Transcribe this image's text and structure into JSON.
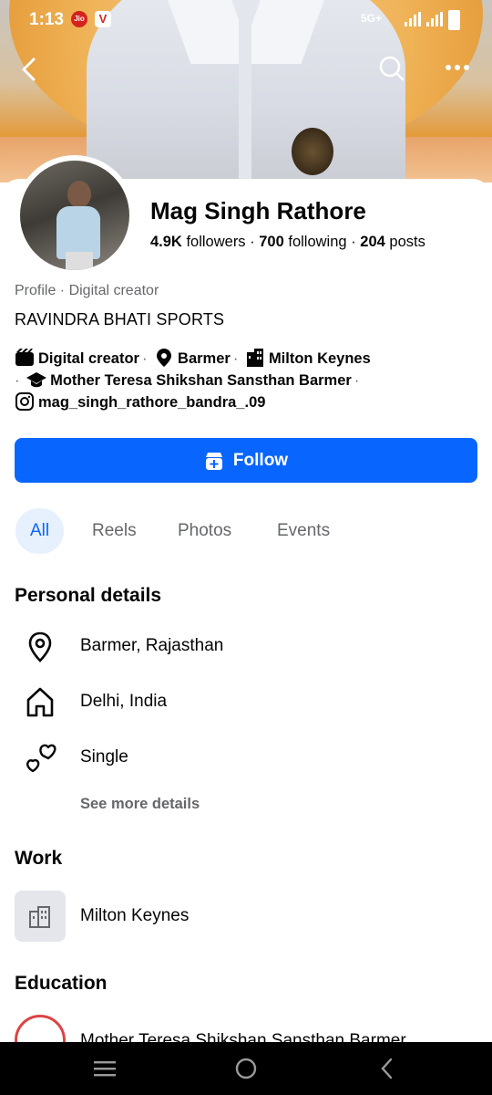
{
  "status_bar": {
    "time": "1:13",
    "jio_label": "Jio",
    "app_letter": "V",
    "network": "5G+"
  },
  "profile": {
    "name": "Mag Singh Rathore",
    "followers_count": "4.9K",
    "followers_label": "followers",
    "following_count": "700",
    "following_label": "following",
    "posts_count": "204",
    "posts_label": "posts",
    "subtitle": "Profile · Digital creator",
    "bio": "RAVINDRA BHATI SPORTS"
  },
  "intro": {
    "category": "Digital creator",
    "location": "Barmer",
    "work": "Milton Keynes",
    "school": "Mother Teresa Shikshan Sansthan Barmer",
    "instagram": "mag_singh_rathore_bandra_.09"
  },
  "actions": {
    "follow_label": "Follow"
  },
  "tabs": [
    {
      "label": "All",
      "active": true
    },
    {
      "label": "Reels",
      "active": false
    },
    {
      "label": "Photos",
      "active": false
    },
    {
      "label": "Events",
      "active": false
    }
  ],
  "personal_details": {
    "title": "Personal details",
    "current_city": "Barmer, Rajasthan",
    "hometown": "Delhi, India",
    "relationship": "Single",
    "see_more_label": "See more details"
  },
  "work": {
    "title": "Work",
    "employer": "Milton Keynes"
  },
  "education": {
    "title": "Education",
    "school": "Mother Teresa Shikshan Sansthan Barmer"
  },
  "colors": {
    "primary": "#0866ff",
    "active_tab_bg": "#e7f0fd",
    "secondary_text": "#65676b"
  }
}
